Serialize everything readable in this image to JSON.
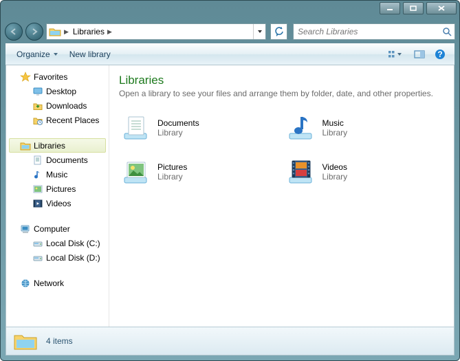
{
  "search": {
    "placeholder": "Search Libraries"
  },
  "breadcrumb": {
    "root": "Libraries"
  },
  "cmdbar": {
    "organize": "Organize",
    "new_library": "New library"
  },
  "sidebar": {
    "favorites": {
      "label": "Favorites",
      "items": [
        "Desktop",
        "Downloads",
        "Recent Places"
      ]
    },
    "libraries": {
      "label": "Libraries",
      "items": [
        "Documents",
        "Music",
        "Pictures",
        "Videos"
      ]
    },
    "computer": {
      "label": "Computer",
      "items": [
        "Local Disk (C:)",
        "Local Disk (D:)"
      ]
    },
    "network": {
      "label": "Network"
    }
  },
  "content": {
    "title": "Libraries",
    "subtitle": "Open a library to see your files and arrange them by folder, date, and other properties.",
    "items": [
      {
        "name": "Documents",
        "type": "Library"
      },
      {
        "name": "Music",
        "type": "Library"
      },
      {
        "name": "Pictures",
        "type": "Library"
      },
      {
        "name": "Videos",
        "type": "Library"
      }
    ]
  },
  "status": {
    "text": "4 items"
  }
}
